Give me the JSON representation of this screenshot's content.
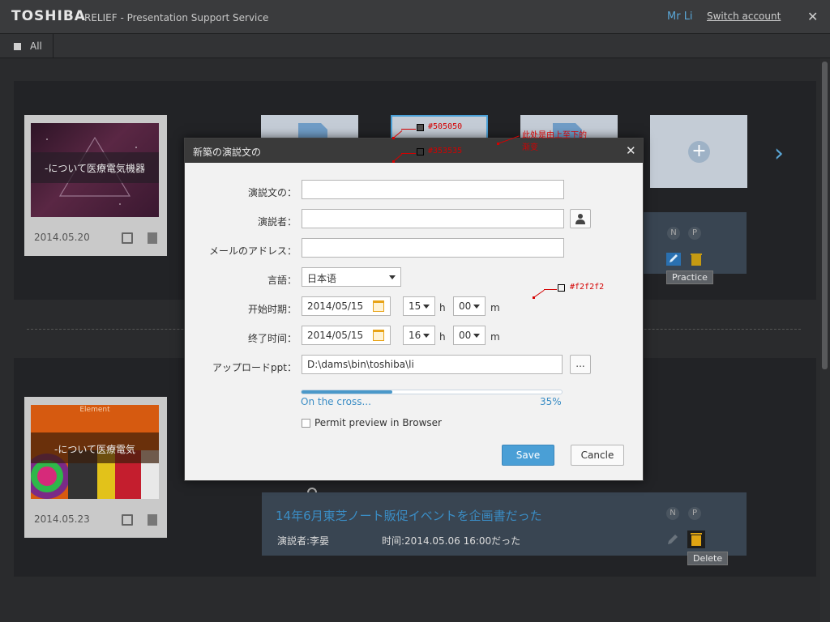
{
  "header": {
    "brand": "TOSHIBA",
    "subtitle": "RELIEF - Presentation Support Service",
    "user": "Mr Li",
    "switch_account": "Switch account",
    "close": "✕"
  },
  "toolbar": {
    "all_label": "All"
  },
  "cards": [
    {
      "slide_text": "-について医療電気機器",
      "date": "2014.05.20",
      "thumb_color": "#4a2038"
    },
    {
      "slide_text": "-について医療電気",
      "slide_header": "Element",
      "date": "2014.05.23",
      "thumb_color": "#d65a10"
    }
  ],
  "info_cards": [
    {
      "n": "N",
      "p": "P",
      "tooltip": "Practice"
    },
    {
      "n": "N",
      "p": "P",
      "tooltip": "Delete",
      "title": "14年6月東芝ノート販促イベントを企画書だった",
      "presenter": "演説者:李晏",
      "time": "时间:2014.05.06 16:00だった"
    }
  ],
  "dialog": {
    "title": "新築の演説文の",
    "close": "✕",
    "labels": {
      "speech": "演説文の：",
      "speaker": "演説者：",
      "email": "メールのアドレス：",
      "language": "言語：",
      "start": "开始时期：",
      "end": "终了时间：",
      "upload": "アップロードppt："
    },
    "language_value": "日本语",
    "start_date": "2014/05/15",
    "start_hour": "15",
    "start_min": "00",
    "end_date": "2014/05/15",
    "end_hour": "16",
    "end_min": "00",
    "h_unit": "h",
    "m_unit": "m",
    "upload_path": "D:\\dams\\bin\\toshiba\\li",
    "browse_label": "...",
    "progress_text": "On the cross...",
    "progress_pct_label": "35%",
    "progress_value": 0.35,
    "permit_label": "Permit preview in Browser",
    "save_label": "Save",
    "cancel_label": "Cancle"
  },
  "annotations": {
    "color1": "#505050",
    "color2": "#353535",
    "color3": "#f2f2f2",
    "note": "此处是由上至下的渐变"
  },
  "colors": {
    "accent": "#4a9fd6",
    "background": "#2a2b2d",
    "panel": "#222326",
    "dialog_bg": "#f2f2f2",
    "annotation": "#d40000"
  }
}
